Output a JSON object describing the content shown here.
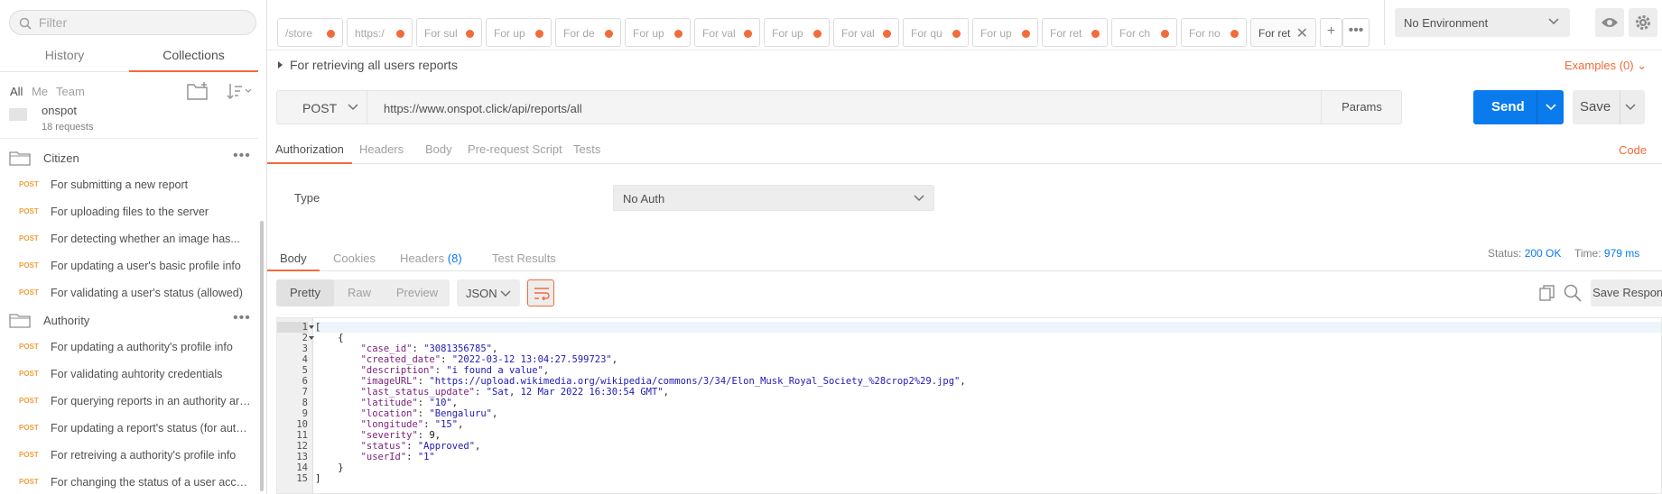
{
  "sidebar": {
    "search_placeholder": "Filter",
    "tabs": {
      "history": "History",
      "collections": "Collections"
    },
    "filters": {
      "all": "All",
      "me": "Me",
      "team": "Team"
    },
    "collection": {
      "name": "onspot",
      "count": "18 requests"
    },
    "folders": [
      {
        "name": "Citizen",
        "dots": "•••"
      },
      {
        "name": "Authority",
        "dots": "•••"
      }
    ],
    "citizen_requests": [
      {
        "method": "POST",
        "name": "For submitting a new report"
      },
      {
        "method": "POST",
        "name": "For uploading files to the server"
      },
      {
        "method": "POST",
        "name": "For detecting whether an image has..."
      },
      {
        "method": "POST",
        "name": "For updating a user's basic profile info"
      },
      {
        "method": "POST",
        "name": "For validating a user's status (allowed)"
      }
    ],
    "authority_requests": [
      {
        "method": "POST",
        "name": "For updating a authority's profile info"
      },
      {
        "method": "POST",
        "name": "For validating auhtority credentials"
      },
      {
        "method": "POST",
        "name": "For querying reports in an authority area"
      },
      {
        "method": "POST",
        "name": "For updating a report's status (for authority)"
      },
      {
        "method": "POST",
        "name": "For retreiving a authority's profile info"
      },
      {
        "method": "POST",
        "name": "For changing the status of a user account"
      }
    ]
  },
  "tabbar": {
    "tabs": [
      {
        "label": "/store"
      },
      {
        "label": "https:/"
      },
      {
        "label": "For sul"
      },
      {
        "label": "For up"
      },
      {
        "label": "For de"
      },
      {
        "label": "For up"
      },
      {
        "label": "For val"
      },
      {
        "label": "For up"
      },
      {
        "label": "For val"
      },
      {
        "label": "For qu"
      },
      {
        "label": "For up"
      },
      {
        "label": "For ret"
      },
      {
        "label": "For ch"
      },
      {
        "label": "For no"
      },
      {
        "label": "For ret",
        "close": "✕"
      }
    ],
    "plus": "+",
    "more": "•••"
  },
  "environment": {
    "selected": "No Environment"
  },
  "request": {
    "title": "For retrieving all users reports",
    "examples": "Examples (0)",
    "method": "POST",
    "url": "https://www.onspot.click/api/reports/all",
    "params_label": "Params",
    "send_label": "Send",
    "save_label": "Save",
    "tabs": [
      "Authorization",
      "Headers",
      "Body",
      "Pre-request Script",
      "Tests"
    ],
    "code_link": "Code",
    "auth": {
      "type_label": "Type",
      "type_value": "No Auth"
    }
  },
  "response": {
    "tabs": {
      "body": "Body",
      "cookies": "Cookies",
      "headers": "Headers",
      "headers_count": "(8)",
      "test_results": "Test Results"
    },
    "status_label": "Status:",
    "status_value": "200 OK",
    "time_label": "Time:",
    "time_value": "979 ms",
    "views": [
      "Pretty",
      "Raw",
      "Preview"
    ],
    "format": "JSON",
    "save_response": "Save Response",
    "line_numbers": [
      "1",
      "2",
      "3",
      "4",
      "5",
      "6",
      "7",
      "8",
      "9",
      "10",
      "11",
      "12",
      "13",
      "14",
      "15"
    ],
    "body_lines": [
      {
        "text": "["
      },
      {
        "text": "    {"
      },
      {
        "key": "\"case_id\"",
        "val": "\"3081356785\"",
        "comma": ","
      },
      {
        "key": "\"created_date\"",
        "val": "\"2022-03-12 13:04:27.599723\"",
        "comma": ","
      },
      {
        "key": "\"description\"",
        "val": "\"i found a value\"",
        "comma": ","
      },
      {
        "key": "\"imageURL\"",
        "val": "\"https://upload.wikimedia.org/wikipedia/commons/3/34/Elon_Musk_Royal_Society_%28crop2%29.jpg\"",
        "comma": ","
      },
      {
        "key": "\"last_status_update\"",
        "val": "\"Sat, 12 Mar 2022 16:30:54 GMT\"",
        "comma": ","
      },
      {
        "key": "\"latitude\"",
        "val": "\"10\"",
        "comma": ","
      },
      {
        "key": "\"location\"",
        "val": "\"Bengaluru\"",
        "comma": ","
      },
      {
        "key": "\"longitude\"",
        "val": "\"15\"",
        "comma": ","
      },
      {
        "key": "\"severity\"",
        "num": "9",
        "comma": ","
      },
      {
        "key": "\"status\"",
        "val": "\"Approved\"",
        "comma": ","
      },
      {
        "key": "\"userId\"",
        "val": "\"1\"",
        "comma": ""
      },
      {
        "text": "    }"
      },
      {
        "text": "]"
      }
    ]
  },
  "colors": {
    "accent": "#f26b3a",
    "primary": "#097bed",
    "method_post": "#f0a03c"
  }
}
